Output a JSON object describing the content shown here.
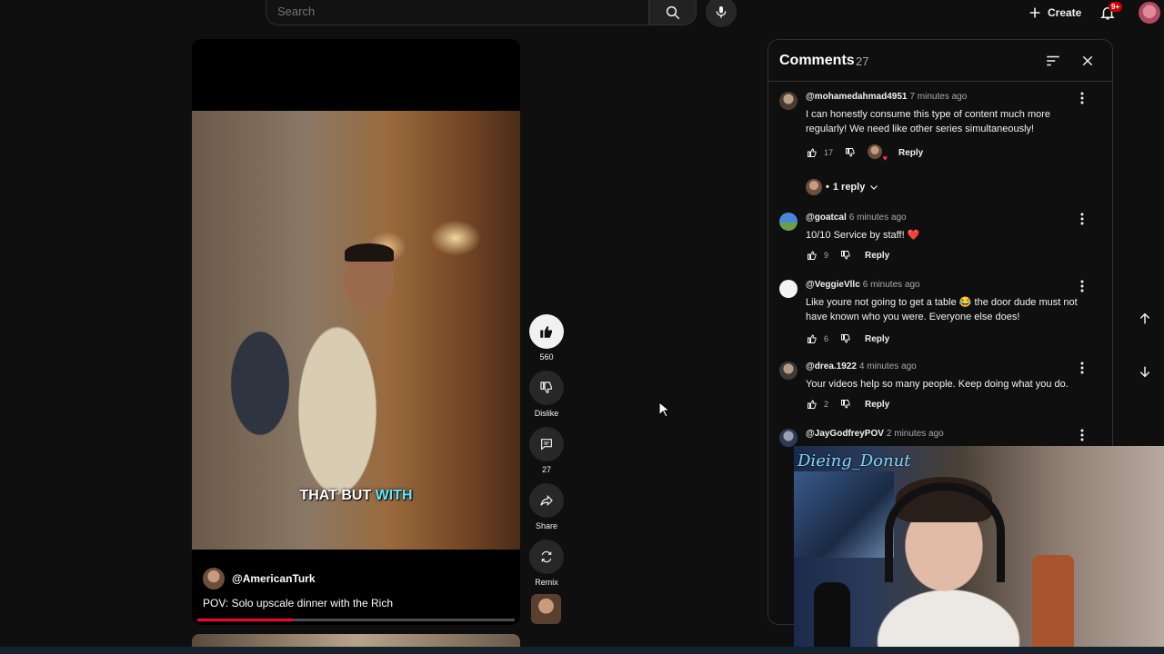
{
  "search": {
    "placeholder": "Search"
  },
  "header": {
    "create_label": "Create",
    "notification_badge": "9+"
  },
  "video": {
    "caption_white": "THAT BUT ",
    "caption_highlight": "WITH",
    "channel": "@AmericanTurk",
    "title": "POV: Solo upscale dinner with the Rich",
    "progress_fraction": 0.3
  },
  "actions": {
    "like_count": "560",
    "dislike_label": "Dislike",
    "comment_count": "27",
    "share_label": "Share",
    "remix_label": "Remix"
  },
  "comments_panel": {
    "title": "Comments",
    "count": "27",
    "comments": [
      {
        "author": "@mohamedahmad4951",
        "time": "7 minutes ago",
        "text": "I can honestly consume this type of content much more regularly! We need like other series simultaneously!",
        "likes": "17",
        "reply_label": "Reply",
        "replies_label": "1 reply"
      },
      {
        "author": "@goatcal",
        "time": "6 minutes ago",
        "text": "10/10 Service by staff! ❤️",
        "likes": "9",
        "reply_label": "Reply"
      },
      {
        "author": "@VeggieVllc",
        "time": "6 minutes ago",
        "text": "Like youre not going to get a table 😂 the door dude must not have known who you were. Everyone else does!",
        "likes": "6",
        "reply_label": "Reply"
      },
      {
        "author": "@drea.1922",
        "time": "4 minutes ago",
        "text": "Your videos help so many people. Keep doing what you do.",
        "likes": "2",
        "reply_label": "Reply"
      },
      {
        "author": "@JayGodfreyPOV",
        "time": "2 minutes ago",
        "text": ""
      }
    ]
  },
  "webcam": {
    "overlay_text": "Dieing_Donut"
  },
  "colors": {
    "accent_red": "#ff0033",
    "caption_highlight": "#5fe8ff",
    "background": "#0f0f0f"
  }
}
